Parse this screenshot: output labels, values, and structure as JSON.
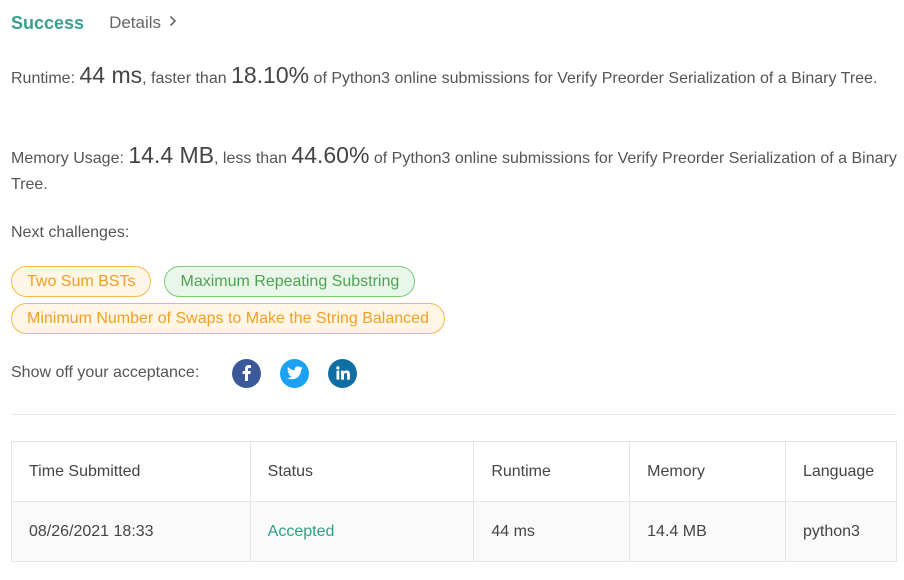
{
  "header": {
    "status": "Success",
    "details_label": "Details",
    "details_icon": "chevron-right-icon"
  },
  "runtime": {
    "label": "Runtime:",
    "value": "44 ms",
    "comparison": ", faster than",
    "percent": "18.10%",
    "suffix": "of Python3 online submissions for Verify Preorder Serialization of a Binary Tree."
  },
  "memory": {
    "label": "Memory Usage:",
    "value": "14.4 MB",
    "comparison": ", less than",
    "percent": "44.60%",
    "suffix": "of Python3 online submissions for Verify Preorder Serialization of a Binary Tree."
  },
  "next": {
    "label": "Next challenges:",
    "challenges": [
      {
        "title": "Two Sum BSTs",
        "difficulty_color": "orange"
      },
      {
        "title": "Maximum Repeating Substring",
        "difficulty_color": "green"
      },
      {
        "title": "Minimum Number of Swaps to Make the String Balanced",
        "difficulty_color": "orange"
      }
    ]
  },
  "share": {
    "label": "Show off your acceptance:",
    "icons": [
      "facebook-icon",
      "twitter-icon",
      "linkedin-icon"
    ]
  },
  "table": {
    "headers": [
      "Time Submitted",
      "Status",
      "Runtime",
      "Memory",
      "Language"
    ],
    "rows": [
      {
        "time": "08/26/2021 18:33",
        "status": "Accepted",
        "runtime": "44 ms",
        "memory": "14.4 MB",
        "language": "python3"
      }
    ]
  },
  "colors": {
    "success": "#3a9f8f",
    "accepted": "#2e9f84",
    "orange_tag": "#f0a024",
    "green_tag": "#4ca450"
  }
}
